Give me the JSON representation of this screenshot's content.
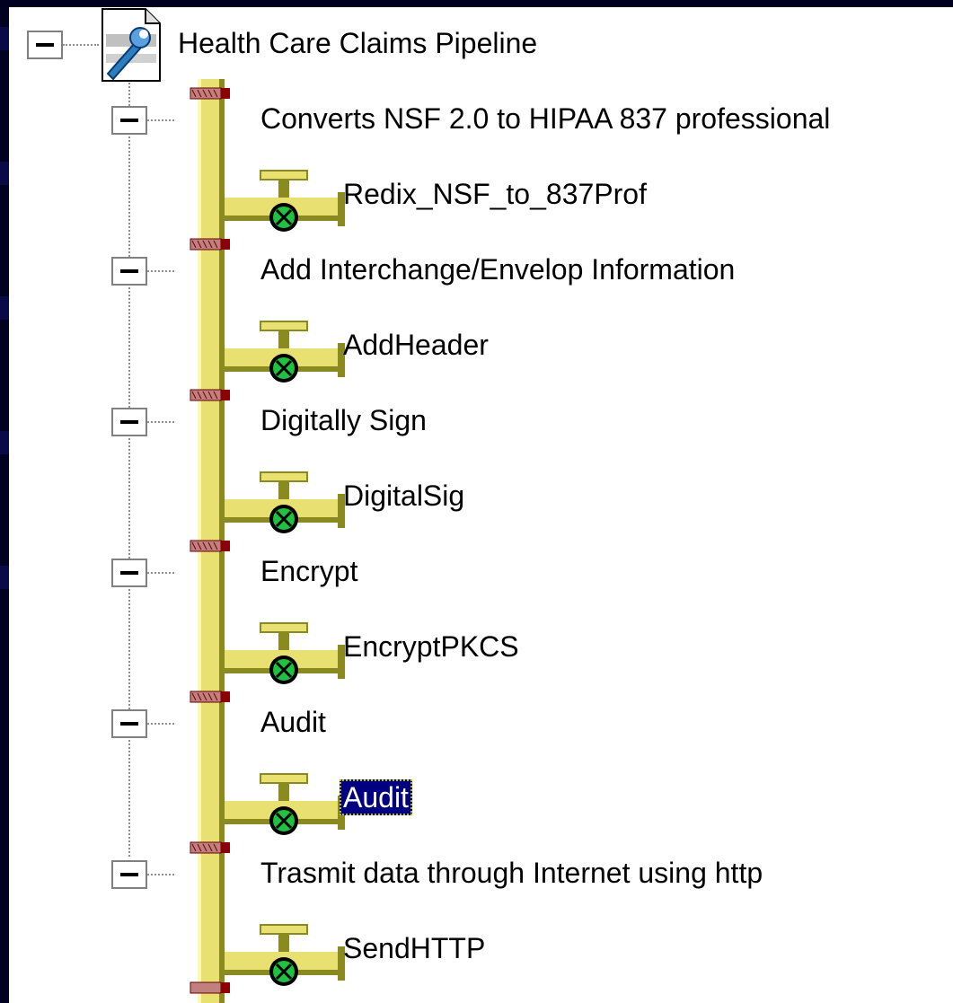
{
  "tree": {
    "root": {
      "label": "Health Care Claims Pipeline",
      "icon": "pipeline-document-icon"
    },
    "stages": [
      {
        "label": "Converts NSF 2.0 to HIPAA 837 professional",
        "component": "Redix_NSF_to_837Prof",
        "selected": false
      },
      {
        "label": "Add Interchange/Envelop Information",
        "component": "AddHeader",
        "selected": false
      },
      {
        "label": "Digitally Sign",
        "component": "DigitalSig",
        "selected": false
      },
      {
        "label": "Encrypt",
        "component": "EncryptPKCS",
        "selected": false
      },
      {
        "label": "Audit",
        "component": "Audit",
        "selected": true
      },
      {
        "label": "Trasmit data through Internet using http",
        "component": "SendHTTP",
        "selected": false
      }
    ]
  },
  "colors": {
    "pipe_yellow": "#e8e070",
    "pipe_shadow": "#8a8a20",
    "flange_red": "#8b0000",
    "valve_green": "#20c040",
    "selection_bg": "#000080"
  }
}
